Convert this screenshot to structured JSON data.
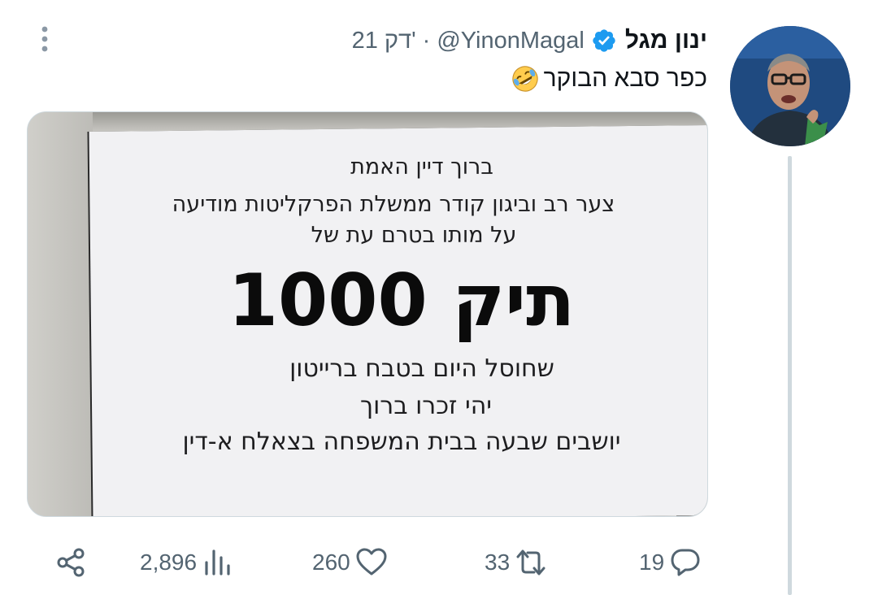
{
  "author": {
    "display_name": "ינון מגל",
    "handle": "@YinonMagal",
    "time": "21 דק'",
    "separator": "·",
    "verified": true
  },
  "tweet": {
    "text": "כפר סבא הבוקר",
    "emoji": "rolling-on-floor-laughing"
  },
  "media": {
    "sign_lines": [
      "ברוך דיין האמת",
      "צער רב וביגון קודר ממשלת הפרקליטות מודיעה",
      "על מותו בטרם עת של",
      "תיק 1000",
      "שחוסל היום בטבח ברייטון",
      "יהי זכרו ברוך",
      "יושבים שבעה בבית המשפחה בצאלח א-דין"
    ]
  },
  "actions": {
    "replies": "19",
    "retweets": "33",
    "likes": "260",
    "views": "2,896"
  },
  "colors": {
    "text": "#0f1419",
    "secondary": "#536471",
    "verified": "#1d9bf0",
    "thread_line": "#cfd9de"
  }
}
